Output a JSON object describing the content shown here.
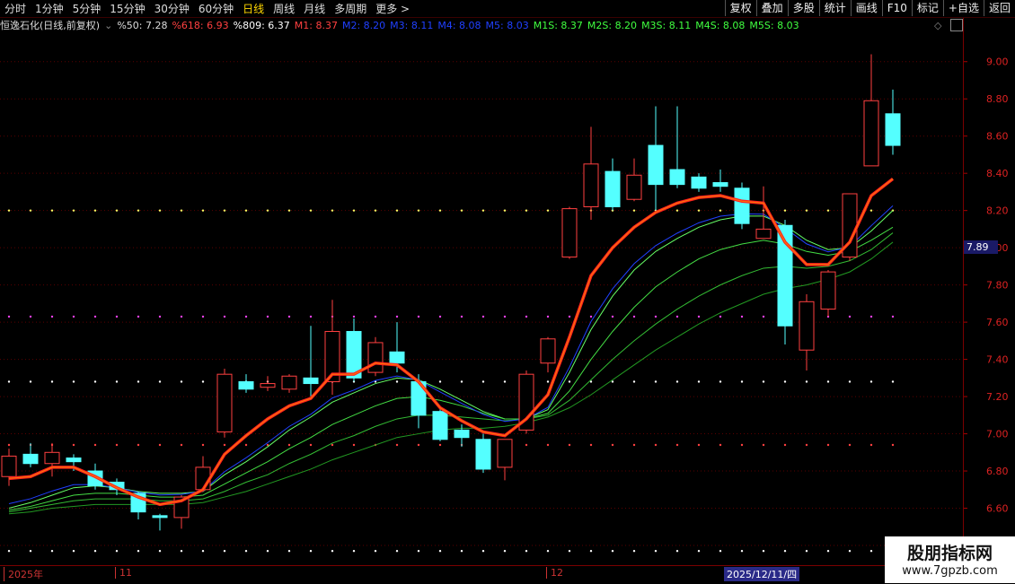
{
  "top_nav": {
    "periods": [
      "分时",
      "1分钟",
      "5分钟",
      "15分钟",
      "30分钟",
      "60分钟",
      "日线",
      "周线",
      "月线",
      "多周期",
      "更多 >"
    ],
    "active_period": "日线",
    "tools": [
      "复权",
      "叠加",
      "多股",
      "统计",
      "画线",
      "F10",
      "标记",
      "+自选",
      "返回"
    ]
  },
  "info_bar": {
    "title": "恒逸石化(日线,前复权)",
    "items": [
      {
        "text": "%50: 7.28",
        "color": "#dddddd"
      },
      {
        "text": "%618: 6.93",
        "color": "#ff4040"
      },
      {
        "text": "%809: 6.37",
        "color": "#ffffff"
      },
      {
        "text": "M1: 8.37",
        "color": "#ff4040"
      },
      {
        "text": "M2: 8.20",
        "color": "#2040ff"
      },
      {
        "text": "M3: 8.11",
        "color": "#2040ff"
      },
      {
        "text": "M4: 8.08",
        "color": "#2040ff"
      },
      {
        "text": "M5: 8.03",
        "color": "#2040ff"
      },
      {
        "text": "M1S: 8.37",
        "color": "#40ff40"
      },
      {
        "text": "M2S: 8.20",
        "color": "#40ff40"
      },
      {
        "text": "M3S: 8.11",
        "color": "#40ff40"
      },
      {
        "text": "M4S: 8.08",
        "color": "#40ff40"
      },
      {
        "text": "M5S: 8.03",
        "color": "#40ff40"
      }
    ]
  },
  "current_price": "7.89",
  "bottom_axis": {
    "labels": [
      {
        "text": "2025年"
      },
      {
        "text": "11"
      },
      {
        "text": "12"
      }
    ],
    "cursor_date": "2025/12/11/四"
  },
  "watermark": {
    "line1": "股朋指标网",
    "line2": "www.7gpzb.com"
  },
  "chart_data": {
    "type": "candlestick",
    "ylim": [
      6.4,
      9.1
    ],
    "yticks": [
      6.4,
      6.6,
      6.8,
      7.0,
      7.2,
      7.4,
      7.6,
      7.8,
      8.0,
      8.2,
      8.4,
      8.6,
      8.8,
      9.0
    ],
    "up_color": "#ff4040",
    "down_color": "#54ffff",
    "candles": [
      {
        "o": 6.77,
        "h": 6.92,
        "l": 6.72,
        "c": 6.88
      },
      {
        "o": 6.89,
        "h": 6.95,
        "l": 6.82,
        "c": 6.84
      },
      {
        "o": 6.84,
        "h": 6.95,
        "l": 6.77,
        "c": 6.9
      },
      {
        "o": 6.87,
        "h": 6.89,
        "l": 6.8,
        "c": 6.85
      },
      {
        "o": 6.8,
        "h": 6.84,
        "l": 6.7,
        "c": 6.72
      },
      {
        "o": 6.74,
        "h": 6.76,
        "l": 6.67,
        "c": 6.7
      },
      {
        "o": 6.68,
        "h": 6.69,
        "l": 6.54,
        "c": 6.58
      },
      {
        "o": 6.56,
        "h": 6.57,
        "l": 6.48,
        "c": 6.55
      },
      {
        "o": 6.55,
        "h": 6.67,
        "l": 6.49,
        "c": 6.66
      },
      {
        "o": 6.7,
        "h": 6.88,
        "l": 6.69,
        "c": 6.82
      },
      {
        "o": 7.01,
        "h": 7.35,
        "l": 6.98,
        "c": 7.32
      },
      {
        "o": 7.28,
        "h": 7.32,
        "l": 7.22,
        "c": 7.24
      },
      {
        "o": 7.25,
        "h": 7.31,
        "l": 7.23,
        "c": 7.27
      },
      {
        "o": 7.24,
        "h": 7.32,
        "l": 7.22,
        "c": 7.31
      },
      {
        "o": 7.3,
        "h": 7.58,
        "l": 7.2,
        "c": 7.27
      },
      {
        "o": 7.28,
        "h": 7.72,
        "l": 7.21,
        "c": 7.55
      },
      {
        "o": 7.55,
        "h": 7.62,
        "l": 7.28,
        "c": 7.3
      },
      {
        "o": 7.33,
        "h": 7.52,
        "l": 7.31,
        "c": 7.49
      },
      {
        "o": 7.44,
        "h": 7.6,
        "l": 7.33,
        "c": 7.38
      },
      {
        "o": 7.28,
        "h": 7.32,
        "l": 7.03,
        "c": 7.1
      },
      {
        "o": 7.12,
        "h": 7.15,
        "l": 6.96,
        "c": 6.97
      },
      {
        "o": 7.02,
        "h": 7.05,
        "l": 6.93,
        "c": 6.98
      },
      {
        "o": 6.97,
        "h": 7.0,
        "l": 6.79,
        "c": 6.81
      },
      {
        "o": 6.82,
        "h": 6.97,
        "l": 6.75,
        "c": 6.97
      },
      {
        "o": 7.02,
        "h": 7.34,
        "l": 7.0,
        "c": 7.32
      },
      {
        "o": 7.38,
        "h": 7.52,
        "l": 7.33,
        "c": 7.51
      },
      {
        "o": 7.95,
        "h": 8.22,
        "l": 7.94,
        "c": 8.21
      },
      {
        "o": 8.22,
        "h": 8.65,
        "l": 8.15,
        "c": 8.45
      },
      {
        "o": 8.41,
        "h": 8.48,
        "l": 8.2,
        "c": 8.22
      },
      {
        "o": 8.26,
        "h": 8.48,
        "l": 8.25,
        "c": 8.39
      },
      {
        "o": 8.55,
        "h": 8.76,
        "l": 8.2,
        "c": 8.34
      },
      {
        "o": 8.42,
        "h": 8.76,
        "l": 8.32,
        "c": 8.34
      },
      {
        "o": 8.38,
        "h": 8.4,
        "l": 8.3,
        "c": 8.32
      },
      {
        "o": 8.35,
        "h": 8.42,
        "l": 8.3,
        "c": 8.33
      },
      {
        "o": 8.32,
        "h": 8.35,
        "l": 8.1,
        "c": 8.13
      },
      {
        "o": 8.05,
        "h": 8.33,
        "l": 8.05,
        "c": 8.1
      },
      {
        "o": 8.12,
        "h": 8.15,
        "l": 7.48,
        "c": 7.58
      },
      {
        "o": 7.45,
        "h": 7.75,
        "l": 7.34,
        "c": 7.71
      },
      {
        "o": 7.67,
        "h": 7.88,
        "l": 7.63,
        "c": 7.87
      },
      {
        "o": 7.95,
        "h": 8.28,
        "l": 7.93,
        "c": 8.29
      },
      {
        "o": 8.44,
        "h": 9.04,
        "l": 8.44,
        "c": 8.79
      },
      {
        "o": 8.72,
        "h": 8.85,
        "l": 8.5,
        "c": 8.55
      }
    ],
    "m1_line": [
      6.76,
      6.77,
      6.82,
      6.82,
      6.77,
      6.71,
      6.66,
      6.62,
      6.64,
      6.7,
      6.89,
      6.99,
      7.08,
      7.15,
      7.19,
      7.32,
      7.32,
      7.38,
      7.37,
      7.28,
      7.14,
      7.07,
      7.01,
      6.99,
      7.08,
      7.21,
      7.52,
      7.85,
      8.0,
      8.11,
      8.19,
      8.24,
      8.27,
      8.28,
      8.25,
      8.24,
      8.03,
      7.91,
      7.91,
      8.03,
      8.28,
      8.37
    ],
    "blue_line": [
      null,
      null,
      null,
      null,
      null,
      null,
      null,
      null,
      null,
      null,
      null,
      null,
      null,
      null,
      null,
      null,
      null,
      null,
      null,
      null,
      null,
      null,
      null,
      null,
      null,
      null,
      null,
      null,
      null,
      null,
      null,
      null,
      null,
      null,
      null,
      null,
      null,
      null,
      null,
      null,
      null,
      null
    ],
    "series": [
      {
        "name": "M2",
        "values": [
          6.6,
          6.63,
          6.67,
          6.71,
          6.72,
          6.71,
          6.69,
          6.68,
          6.68,
          6.69,
          6.78,
          6.85,
          6.93,
          7.02,
          7.09,
          7.17,
          7.22,
          7.27,
          7.3,
          7.29,
          7.24,
          7.18,
          7.12,
          7.08,
          7.08,
          7.13,
          7.33,
          7.56,
          7.74,
          7.88,
          7.98,
          8.05,
          8.11,
          8.15,
          8.17,
          8.17,
          8.12,
          8.04,
          7.99,
          8.0,
          8.09,
          8.2
        ]
      },
      {
        "name": "M3",
        "values": [
          6.59,
          6.61,
          6.64,
          6.67,
          6.68,
          6.68,
          6.67,
          6.66,
          6.66,
          6.67,
          6.73,
          6.79,
          6.85,
          6.92,
          6.98,
          7.05,
          7.1,
          7.15,
          7.19,
          7.2,
          7.18,
          7.15,
          7.11,
          7.08,
          7.08,
          7.11,
          7.23,
          7.4,
          7.55,
          7.68,
          7.79,
          7.87,
          7.94,
          7.99,
          8.02,
          8.04,
          8.02,
          7.98,
          7.96,
          7.98,
          8.04,
          8.11
        ]
      },
      {
        "name": "M4",
        "values": [
          6.58,
          6.6,
          6.62,
          6.64,
          6.65,
          6.65,
          6.65,
          6.64,
          6.64,
          6.65,
          6.69,
          6.74,
          6.78,
          6.84,
          6.89,
          6.95,
          6.99,
          7.04,
          7.08,
          7.1,
          7.1,
          7.09,
          7.08,
          7.07,
          7.08,
          7.1,
          7.18,
          7.29,
          7.4,
          7.5,
          7.59,
          7.67,
          7.74,
          7.8,
          7.85,
          7.89,
          7.9,
          7.89,
          7.9,
          7.93,
          7.99,
          8.08
        ]
      },
      {
        "name": "M5",
        "values": [
          6.57,
          6.58,
          6.6,
          6.61,
          6.62,
          6.62,
          6.62,
          6.62,
          6.62,
          6.63,
          6.66,
          6.69,
          6.73,
          6.77,
          6.81,
          6.86,
          6.9,
          6.94,
          6.98,
          7.0,
          7.02,
          7.03,
          7.03,
          7.04,
          7.06,
          7.09,
          7.14,
          7.21,
          7.29,
          7.37,
          7.45,
          7.52,
          7.59,
          7.65,
          7.7,
          7.75,
          7.78,
          7.8,
          7.83,
          7.87,
          7.94,
          8.03
        ]
      }
    ],
    "dotted_levels": [
      {
        "value": 8.2,
        "color": "#ffff66"
      },
      {
        "value": 7.63,
        "color": "#ff44ff"
      },
      {
        "value": 7.28,
        "color": "#ffffff"
      },
      {
        "value": 6.94,
        "color": "#ff4040"
      },
      {
        "value": 6.37,
        "color": "#ffffff"
      }
    ]
  }
}
